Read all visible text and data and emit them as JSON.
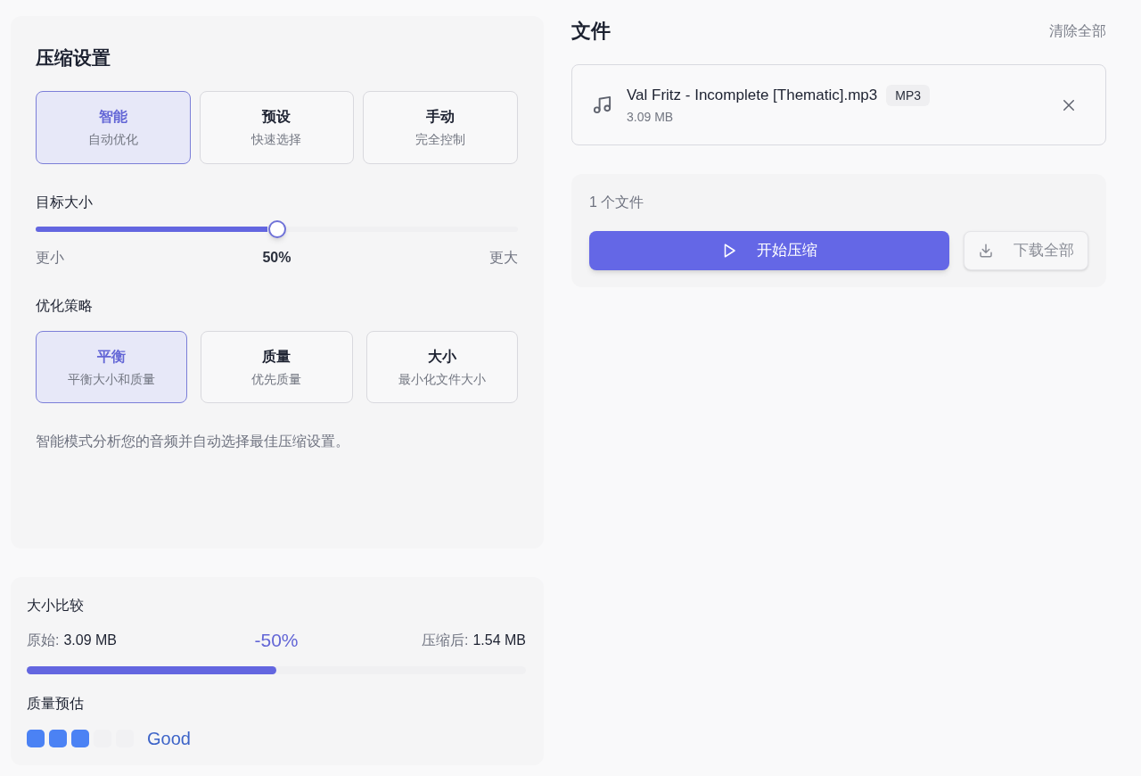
{
  "compression_settings": {
    "title": "压缩设置",
    "modes": [
      {
        "label": "智能",
        "description": "自动优化",
        "selected": true
      },
      {
        "label": "预设",
        "description": "快速选择",
        "selected": false
      },
      {
        "label": "手动",
        "description": "完全控制",
        "selected": false
      }
    ],
    "target_size": {
      "label": "目标大小",
      "level": 0.5,
      "min_label": "更小",
      "reading": "50%",
      "max_label": "更大"
    },
    "strategy": {
      "label": "优化策略",
      "options": [
        {
          "label": "平衡",
          "description": "平衡大小和质量",
          "selected": true
        },
        {
          "label": "质量",
          "description": "优先质量",
          "selected": false
        },
        {
          "label": "大小",
          "description": "最小化文件大小",
          "selected": false
        }
      ]
    },
    "description": "智能模式分析您的音频并自动选择最佳压缩设置。"
  },
  "size_comparison": {
    "title": "大小比较",
    "original_label": "原始:",
    "original_value": "3.09 MB",
    "change": "-50%",
    "compressed_label": "压缩后:",
    "compressed_value": "1.54 MB",
    "bar": {
      "level": 0.5
    },
    "quality_label": "质量预估",
    "quality": {
      "stars": 3,
      "text": "Good"
    }
  },
  "files": {
    "title": "文件",
    "clear_all": "清除全部",
    "items": [
      {
        "name": "Val Fritz - Incomplete [Thematic].mp3",
        "format": "MP3",
        "size": "3.09 MB"
      }
    ]
  },
  "actions": {
    "count": "1 个文件",
    "start_button": {
      "label": "开始压缩"
    },
    "download_button": {
      "label": "下载全部",
      "disabled": true
    }
  }
}
